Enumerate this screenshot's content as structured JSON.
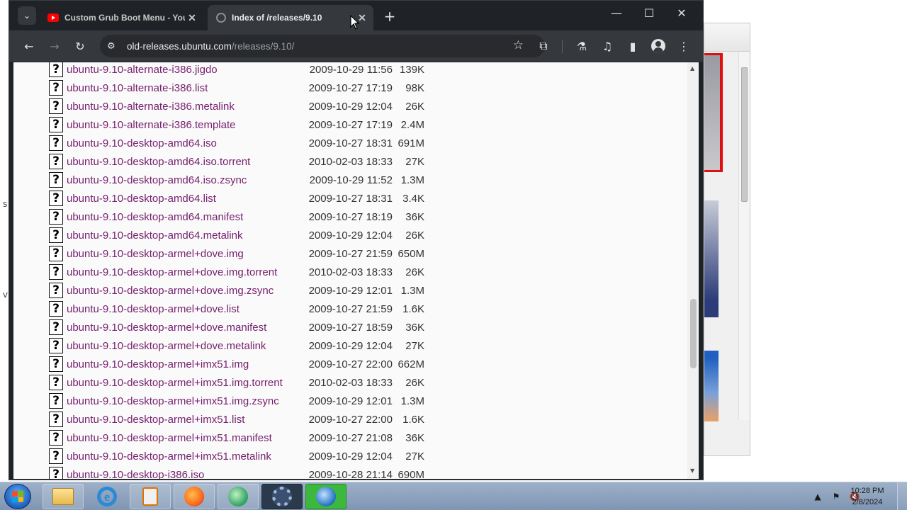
{
  "desktop": {
    "side_letters": [
      "S",
      "V"
    ]
  },
  "browser": {
    "tabs": [
      {
        "title": "Custom Grub Boot Menu - You",
        "favicon": "youtube-icon",
        "active": false
      },
      {
        "title": "Index of /releases/9.10",
        "favicon": "globe-icon",
        "active": true
      }
    ],
    "url_host": "old-releases.ubuntu.com",
    "url_path": "/releases/9.10/"
  },
  "listing": {
    "rows": [
      {
        "name": "ubuntu-9.10-alternate-i386.jigdo",
        "date": "2009-10-29 11:56",
        "size": "139K"
      },
      {
        "name": "ubuntu-9.10-alternate-i386.list",
        "date": "2009-10-27 17:19",
        "size": "98K"
      },
      {
        "name": "ubuntu-9.10-alternate-i386.metalink",
        "date": "2009-10-29 12:04",
        "size": "26K"
      },
      {
        "name": "ubuntu-9.10-alternate-i386.template",
        "date": "2009-10-27 17:19",
        "size": "2.4M"
      },
      {
        "name": "ubuntu-9.10-desktop-amd64.iso",
        "date": "2009-10-27 18:31",
        "size": "691M"
      },
      {
        "name": "ubuntu-9.10-desktop-amd64.iso.torrent",
        "date": "2010-02-03 18:33",
        "size": "27K"
      },
      {
        "name": "ubuntu-9.10-desktop-amd64.iso.zsync",
        "date": "2009-10-29 11:52",
        "size": "1.3M"
      },
      {
        "name": "ubuntu-9.10-desktop-amd64.list",
        "date": "2009-10-27 18:31",
        "size": "3.4K"
      },
      {
        "name": "ubuntu-9.10-desktop-amd64.manifest",
        "date": "2009-10-27 18:19",
        "size": "36K"
      },
      {
        "name": "ubuntu-9.10-desktop-amd64.metalink",
        "date": "2009-10-29 12:04",
        "size": "26K"
      },
      {
        "name": "ubuntu-9.10-desktop-armel+dove.img",
        "date": "2009-10-27 21:59",
        "size": "650M"
      },
      {
        "name": "ubuntu-9.10-desktop-armel+dove.img.torrent",
        "date": "2010-02-03 18:33",
        "size": "26K"
      },
      {
        "name": "ubuntu-9.10-desktop-armel+dove.img.zsync",
        "date": "2009-10-29 12:01",
        "size": "1.3M"
      },
      {
        "name": "ubuntu-9.10-desktop-armel+dove.list",
        "date": "2009-10-27 21:59",
        "size": "1.6K"
      },
      {
        "name": "ubuntu-9.10-desktop-armel+dove.manifest",
        "date": "2009-10-27 18:59",
        "size": "36K"
      },
      {
        "name": "ubuntu-9.10-desktop-armel+dove.metalink",
        "date": "2009-10-29 12:04",
        "size": "27K"
      },
      {
        "name": "ubuntu-9.10-desktop-armel+imx51.img",
        "date": "2009-10-27 22:00",
        "size": "662M"
      },
      {
        "name": "ubuntu-9.10-desktop-armel+imx51.img.torrent",
        "date": "2010-02-03 18:33",
        "size": "26K"
      },
      {
        "name": "ubuntu-9.10-desktop-armel+imx51.img.zsync",
        "date": "2009-10-29 12:01",
        "size": "1.3M"
      },
      {
        "name": "ubuntu-9.10-desktop-armel+imx51.list",
        "date": "2009-10-27 22:00",
        "size": "1.6K"
      },
      {
        "name": "ubuntu-9.10-desktop-armel+imx51.manifest",
        "date": "2009-10-27 21:08",
        "size": "36K"
      },
      {
        "name": "ubuntu-9.10-desktop-armel+imx51.metalink",
        "date": "2009-10-29 12:04",
        "size": "27K"
      },
      {
        "name": "ubuntu-9.10-desktop-i386.iso",
        "date": "2009-10-28 21:14",
        "size": "690M"
      }
    ],
    "file_icon_glyph": "?"
  },
  "taskbar": {
    "apps": [
      {
        "name": "explorer",
        "icon": "folder-icon"
      },
      {
        "name": "internet-explorer",
        "icon": "ie-icon"
      },
      {
        "name": "media-player",
        "icon": "media-icon"
      },
      {
        "name": "firefox",
        "icon": "firefox-icon"
      },
      {
        "name": "app-green",
        "icon": "green-orb-icon"
      },
      {
        "name": "app-gear",
        "icon": "gear-icon"
      },
      {
        "name": "app-globe",
        "icon": "globe-icon"
      }
    ],
    "clock_time": "10:28 PM",
    "clock_date": "2/8/2024"
  },
  "colors": {
    "link": "#77216f",
    "chrome_dark": "#1f2226",
    "chrome_toolbar": "#35383c"
  }
}
